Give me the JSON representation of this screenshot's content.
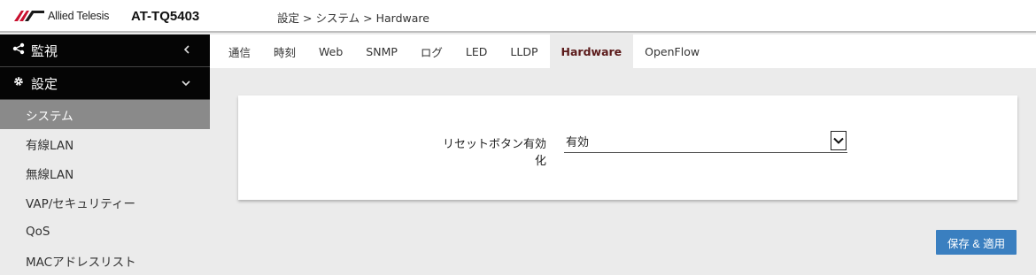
{
  "header": {
    "logo_text": "Allied Telesis",
    "model": "AT-TQ5403",
    "breadcrumb": [
      "設定",
      "システム",
      "Hardware"
    ],
    "breadcrumb_sep": ">"
  },
  "sidebar": {
    "main": [
      {
        "label": "監視",
        "icon": "share-icon",
        "chevron": "‹"
      },
      {
        "label": "設定",
        "icon": "gear-icon",
        "chevron": "⌄"
      }
    ],
    "items": [
      {
        "label": "システム",
        "active": true
      },
      {
        "label": "有線LAN"
      },
      {
        "label": "無線LAN"
      },
      {
        "label": "VAP/セキュリティー"
      },
      {
        "label": "QoS"
      },
      {
        "label": "MACアドレスリスト"
      }
    ]
  },
  "tabs": [
    "通信",
    "時刻",
    "Web",
    "SNMP",
    "ログ",
    "LED",
    "LLDP",
    "Hardware",
    "OpenFlow"
  ],
  "active_tab": "Hardware",
  "form": {
    "reset_button_label": "リセットボタン有効化",
    "reset_button_value": "有効"
  },
  "save_button": "保存 & 適用",
  "colors": {
    "accent": "#3a7fc0",
    "active_tab_text": "#5b1a1a",
    "sidebar_dark": "#050505",
    "sidebar_active": "#8a8a8a"
  }
}
